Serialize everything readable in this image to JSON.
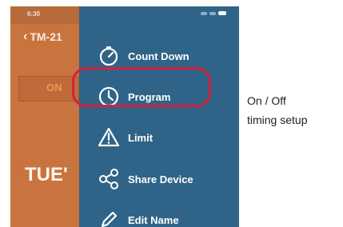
{
  "statusbar": {
    "time": "6:30"
  },
  "background_screen": {
    "back_label": "TM-21",
    "on_label": "ON",
    "day_label": "TUE'"
  },
  "drawer": {
    "items": [
      {
        "label": "Count Down",
        "icon": "stopwatch-icon"
      },
      {
        "label": "Program",
        "icon": "clock-icon"
      },
      {
        "label": "Limit",
        "icon": "warning-triangle-icon"
      },
      {
        "label": "Share Device",
        "icon": "share-icon"
      },
      {
        "label": "Edit Name",
        "icon": "pencil-icon"
      }
    ]
  },
  "annotation": {
    "line1": "On / Off",
    "line2": "timing setup"
  },
  "colors": {
    "drawer_background": "#2f6488",
    "background_screen": "#c9743f",
    "highlight": "#d8203b"
  }
}
